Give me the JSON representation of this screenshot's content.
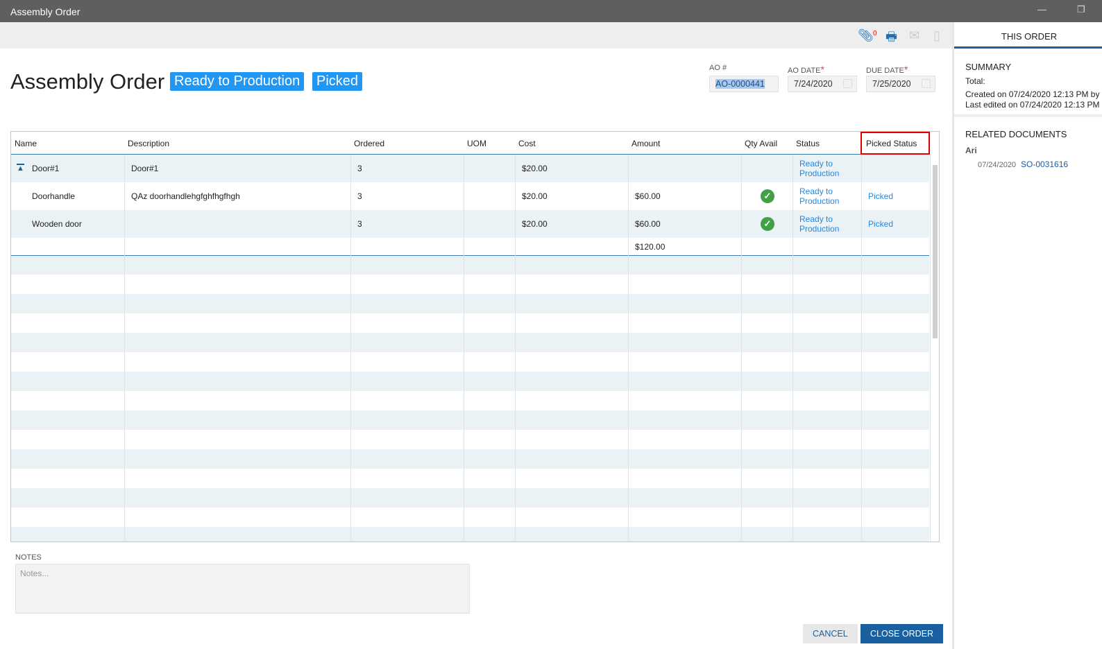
{
  "window": {
    "title": "Assembly Order"
  },
  "toolbar": {
    "attachment_count": "0"
  },
  "header": {
    "title": "Assembly Order",
    "badges": [
      "Ready to Production",
      "Picked"
    ],
    "ao_number_label": "AO #",
    "ao_number": "AO-0000441",
    "ao_date_label": "AO DATE",
    "ao_date": "7/24/2020",
    "due_date_label": "DUE DATE",
    "due_date": "7/25/2020",
    "required_mark": "*"
  },
  "grid": {
    "columns": [
      "Name",
      "Description",
      "Ordered",
      "UOM",
      "Cost",
      "Amount",
      "Qty Avail",
      "Status",
      "Picked Status"
    ],
    "rows": [
      {
        "name": "Door#1",
        "description": "Door#1",
        "ordered": "3",
        "uom": "",
        "cost": "$20.00",
        "amount": "",
        "qty_avail": false,
        "status": "Ready to Production",
        "picked_status": ""
      },
      {
        "name": "Doorhandle",
        "description": "QAz doorhandlehgfghfhgfhgh",
        "ordered": "3",
        "uom": "",
        "cost": "$20.00",
        "amount": "$60.00",
        "qty_avail": true,
        "status": "Ready to Production",
        "picked_status": "Picked"
      },
      {
        "name": "Wooden door",
        "description": "",
        "ordered": "3",
        "uom": "",
        "cost": "$20.00",
        "amount": "$60.00",
        "qty_avail": true,
        "status": "Ready to Production",
        "picked_status": "Picked"
      }
    ],
    "total_amount": "$120.00"
  },
  "notes": {
    "label": "NOTES",
    "placeholder": "Notes..."
  },
  "buttons": {
    "cancel": "CANCEL",
    "close_order": "CLOSE ORDER"
  },
  "side": {
    "tab": "THIS ORDER",
    "summary_title": "SUMMARY",
    "total_label": "Total:",
    "created": "Created on 07/24/2020 12:13 PM by",
    "edited": "Last edited on 07/24/2020 12:13 PM",
    "related_title": "RELATED DOCUMENTS",
    "related_group": "Ari",
    "related_date": "07/24/2020",
    "related_doc": "SO-0031616"
  },
  "colors": {
    "accent": "#2196f3",
    "link": "#1e88e5",
    "highlight": "#e00000"
  }
}
